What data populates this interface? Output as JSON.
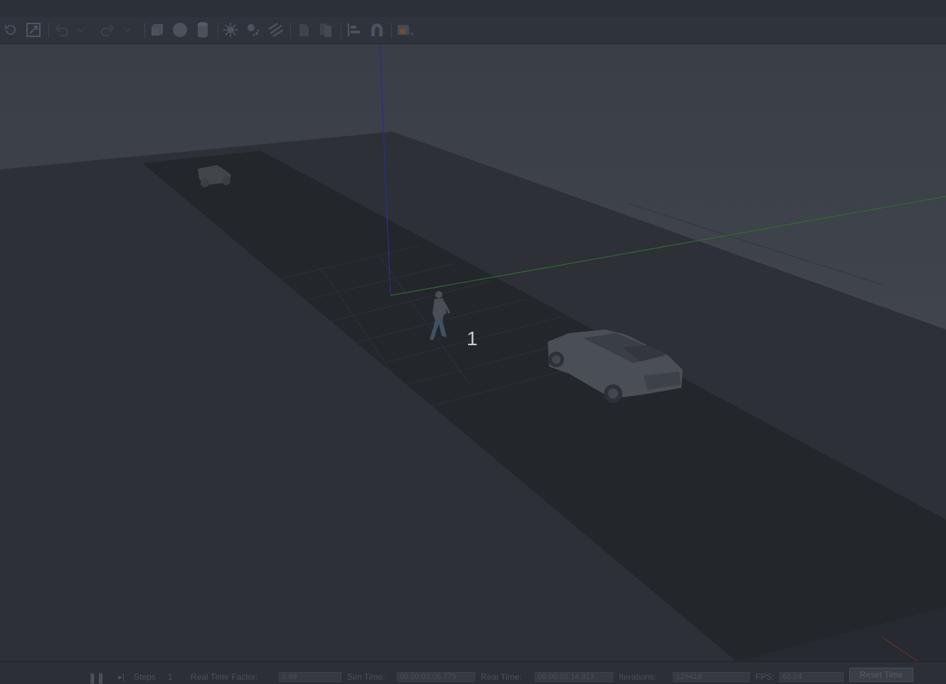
{
  "toolbar": {
    "tools": [
      {
        "name": "rotate-icon"
      },
      {
        "name": "scale-icon"
      },
      {
        "name": "undo-icon"
      },
      {
        "name": "redo-icon"
      },
      {
        "name": "box-shape-icon"
      },
      {
        "name": "sphere-shape-icon"
      },
      {
        "name": "cylinder-shape-icon"
      },
      {
        "name": "point-light-icon"
      },
      {
        "name": "spot-light-icon"
      },
      {
        "name": "directional-light-icon"
      },
      {
        "name": "copy-icon"
      },
      {
        "name": "paste-icon"
      },
      {
        "name": "align-icon"
      },
      {
        "name": "snap-icon"
      },
      {
        "name": "screenshot-icon"
      }
    ]
  },
  "viewport": {
    "overlay_label": "1",
    "axis_colors": {
      "z": "#2a2f8a",
      "y": "#2f6b2f",
      "x": "#7a2f2f"
    }
  },
  "bottom_bar": {
    "pause_icon": "pause-icon",
    "step_label": "Steps",
    "step_value": "1",
    "real_time_factor_label": "Real Time Factor:",
    "real_time_factor_value": "0.99",
    "sim_time_label": "Sim Time:",
    "sim_time_value": "00 00:02:05.779",
    "real_time_label": "Real Time:",
    "real_time_value": "00 00:02:14.913",
    "iterations_label": "Iterations:",
    "iterations_value": "125418",
    "fps_label": "FPS:",
    "fps_value": "60.04",
    "reset_time_label": "Reset Time"
  }
}
